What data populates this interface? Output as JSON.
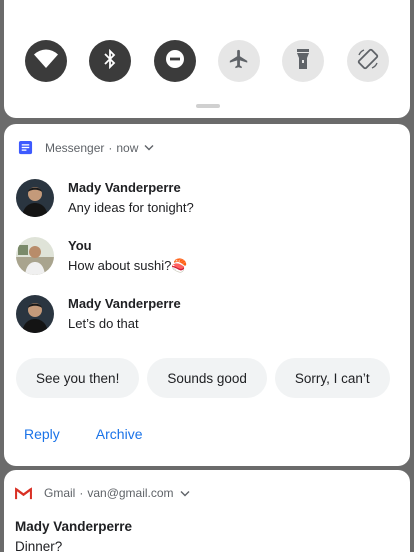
{
  "status_bar": {
    "icons": [
      "alarm-icon",
      "bluetooth-icon",
      "cast-icon",
      "do-not-disturb-icon",
      "wifi-icon",
      "signal-icon"
    ]
  },
  "quick_settings": {
    "tiles": [
      {
        "name": "wifi",
        "icon": "wifi-icon",
        "state": "on"
      },
      {
        "name": "bluetooth",
        "icon": "bluetooth-icon",
        "state": "on"
      },
      {
        "name": "do-not-disturb",
        "icon": "do-not-disturb-icon",
        "state": "on"
      },
      {
        "name": "airplane-mode",
        "icon": "airplane-icon",
        "state": "off"
      },
      {
        "name": "flashlight",
        "icon": "flashlight-icon",
        "state": "off"
      },
      {
        "name": "auto-rotate",
        "icon": "auto-rotate-icon",
        "state": "off"
      }
    ]
  },
  "messenger": {
    "app_name": "Messenger",
    "separator": "·",
    "time": "now",
    "messages": [
      {
        "sender": "Mady Vanderperre",
        "text": "Any ideas for tonight?"
      },
      {
        "sender": "You",
        "text": "How about sushi?🍣"
      },
      {
        "sender": "Mady Vanderperre",
        "text": "Let’s do that"
      }
    ],
    "smart_replies": [
      "See you then!",
      "Sounds good",
      "Sorry, I can’t"
    ],
    "actions": [
      "Reply",
      "Archive"
    ]
  },
  "gmail": {
    "app_name": "Gmail",
    "separator": "·",
    "account": "van@gmail.com",
    "sender": "Mady Vanderperre",
    "subject": "Dinner?"
  },
  "colors": {
    "accent": "#1a73e8",
    "messenger_icon": "#3d5afe",
    "gmail_red": "#d93025",
    "tile_on": "#3b3b3b",
    "tile_off": "#e6e6e6"
  }
}
